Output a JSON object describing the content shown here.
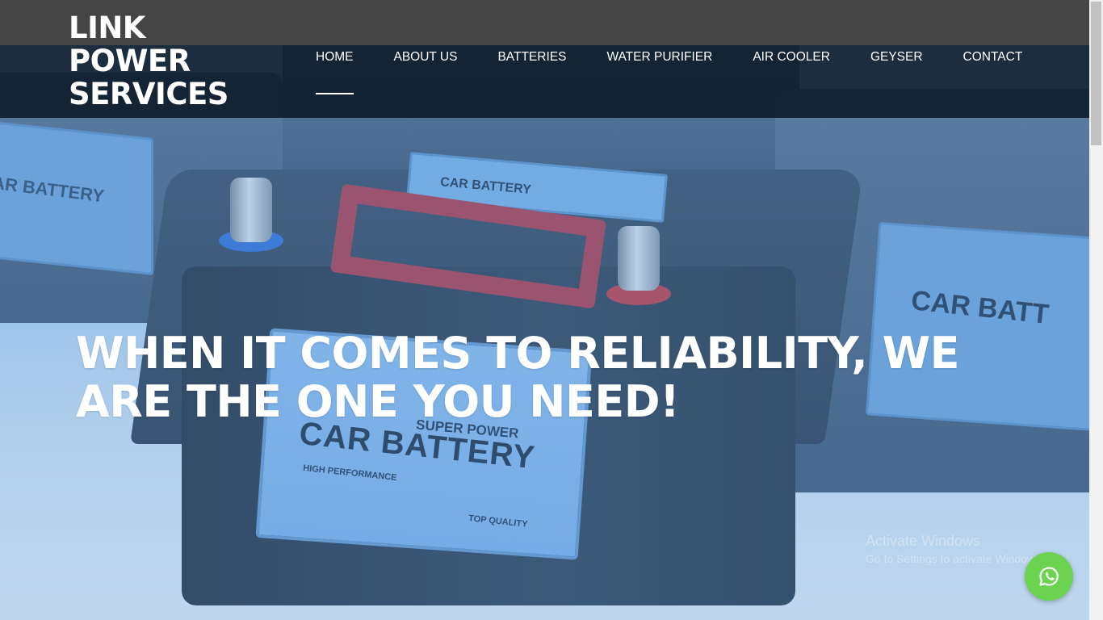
{
  "header": {
    "logo_lines": [
      "LINK",
      "POWER",
      "SERVICES"
    ]
  },
  "nav": {
    "items": [
      {
        "label": "HOME",
        "active": true
      },
      {
        "label": "ABOUT US",
        "active": false
      },
      {
        "label": "BATTERIES",
        "active": false
      },
      {
        "label": "WATER PURIFIER",
        "active": false
      },
      {
        "label": "AIR COOLER",
        "active": false
      },
      {
        "label": "GEYSER",
        "active": false
      },
      {
        "label": "CONTACT",
        "active": false
      }
    ]
  },
  "hero": {
    "headline": "WHEN IT COMES TO RELIABILITY, WE ARE THE ONE YOU NEED!",
    "image_texts": {
      "back_left_label": "AR BATTERY",
      "back_right_label": "CAR BATT",
      "lid_label": "CAR BATTERY",
      "front_super": "SUPER POWER",
      "front_car": "CAR BATTERY",
      "front_high": "HIGH PERFORMANCE",
      "front_top": "TOP QUALITY"
    }
  },
  "watermark": {
    "title": "Activate Windows",
    "subtitle": "Go to Settings to activate Windows."
  },
  "whatsapp": {
    "icon": "whatsapp-icon",
    "color": "#6bd34f"
  },
  "colors": {
    "topbar": "#454545",
    "navbar": "#0b1a28",
    "text": "#ffffff"
  }
}
